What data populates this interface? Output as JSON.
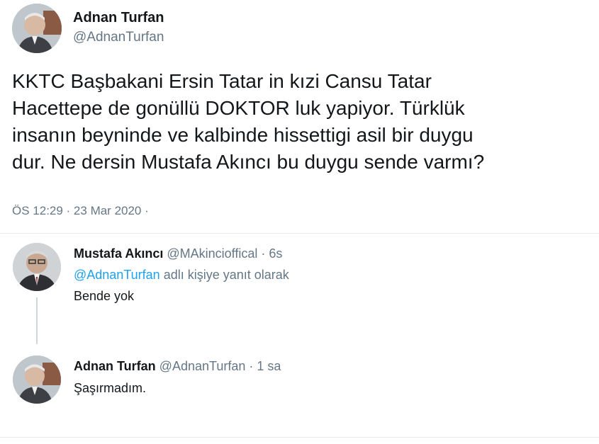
{
  "main_tweet": {
    "author_name": "Adnan Turfan",
    "author_handle": "@AdnanTurfan",
    "text_lines": [
      "KKTC Başbakani Ersin Tatar in kızi Cansu Tatar",
      "Hacettepe de gonüllü DOKTOR luk yapiyor. Türklük",
      "insanın beyninde ve kalbinde hissettigi asil bir duygu",
      "dur. Ne dersin Mustafa Akıncı bu duygu sende varmı?"
    ],
    "timestamp": "ÖS 12:29 · 23 Mar 2020 ·"
  },
  "replies": [
    {
      "author_name": "Mustafa Akıncı",
      "author_handle": "@MAkincioffical",
      "time": "· 6s",
      "reply_to_mention": "@AdnanTurfan",
      "reply_to_suffix": " adlı kişiye yanıt olarak",
      "text": "Bende yok"
    },
    {
      "author_name": "Adnan Turfan",
      "author_handle": "@AdnanTurfan",
      "time": "· 1 sa",
      "text": "Şaşırmadım."
    }
  ],
  "colors": {
    "text_primary": "#14171a",
    "text_secondary": "#657786",
    "link": "#1da1f2",
    "divider": "#e6ecf0",
    "thread_line": "#ccd6dd"
  }
}
